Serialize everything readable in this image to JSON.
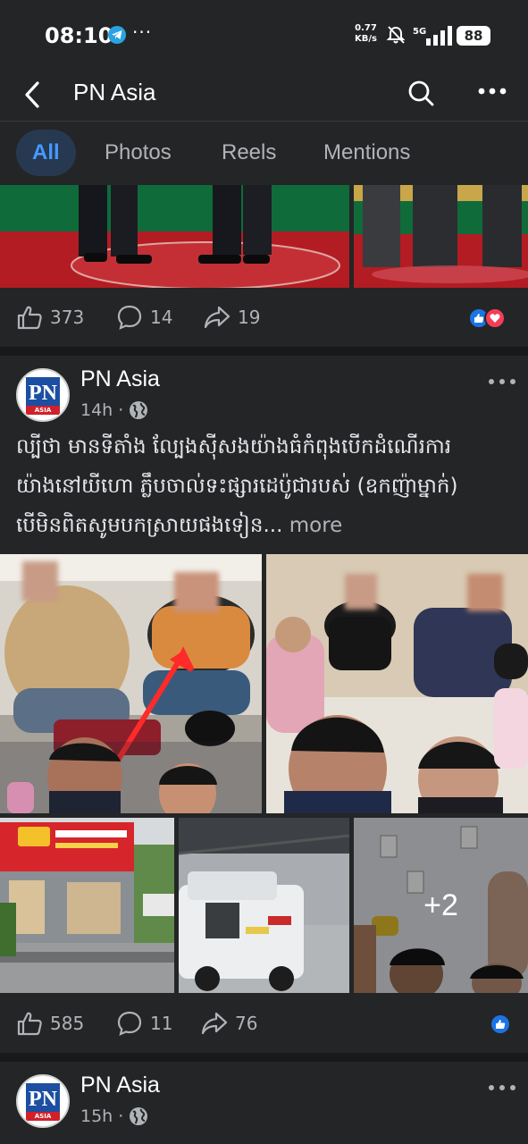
{
  "status": {
    "time": "08:10",
    "more": "···",
    "net_speed_value": "0.77",
    "net_speed_unit": "KB/s",
    "network": "5G",
    "battery": "88"
  },
  "app_bar": {
    "title": "PN Asia"
  },
  "tabs": [
    {
      "label": "All",
      "active": true
    },
    {
      "label": "Photos",
      "active": false
    },
    {
      "label": "Reels",
      "active": false
    },
    {
      "label": "Mentions",
      "active": false
    }
  ],
  "post0": {
    "likes": "373",
    "comments": "14",
    "shares": "19"
  },
  "post1": {
    "author": "PN Asia",
    "time": "14h",
    "caption_line1": "ល្បីថា មានទីតាំង ល្បែងស៊ីសងយ៉ាងធំកំពុងបើកដំណើរការ",
    "caption_line2": "យ៉ាងនៅយីហោ ភ្លឹបចាល់ទះផ្សារដេប៉ូជារបស់ (ឧកញ៉ាម្នាក់)",
    "caption_line3": "បើមិនពិតសូមបកស្រាយផងទៀន...",
    "more": "more",
    "extra_photos": "+2",
    "likes": "585",
    "comments": "11",
    "shares": "76"
  },
  "post2": {
    "author": "PN Asia",
    "time": "15h"
  },
  "avatar_text": {
    "mark": "PN",
    "sub": "ASIA"
  },
  "colors": {
    "bg": "#242526",
    "accent": "#4599ff",
    "like": "#1b74e4",
    "love": "#f33e58"
  }
}
